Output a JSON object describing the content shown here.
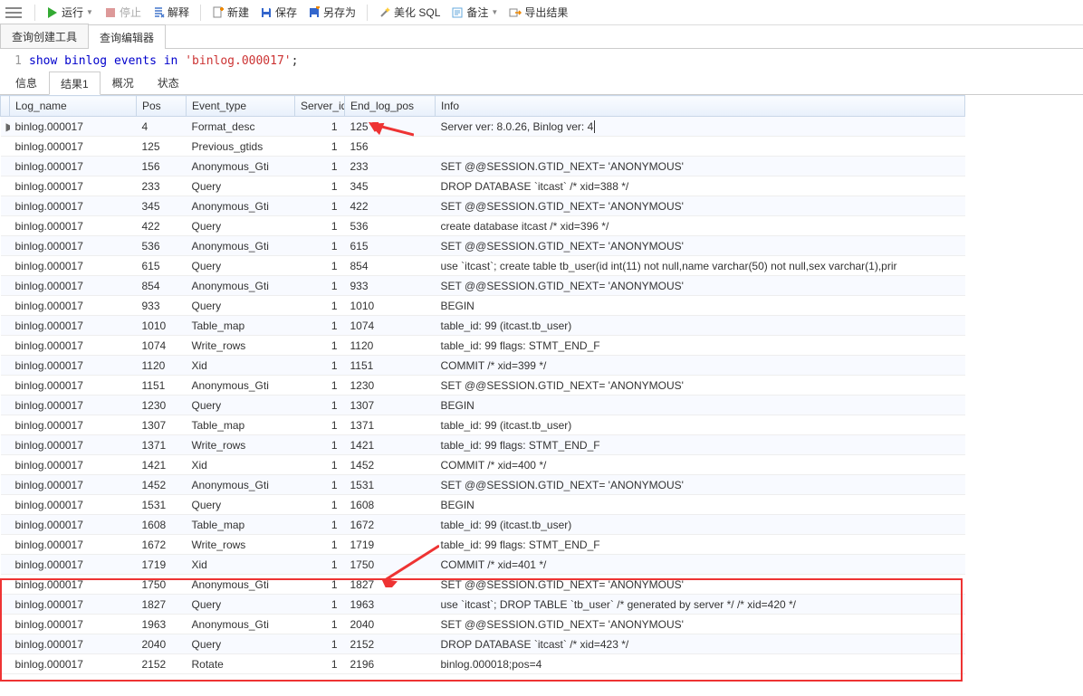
{
  "toolbar": {
    "run": "运行",
    "stop": "停止",
    "explain": "解释",
    "new": "新建",
    "save": "保存",
    "saveas": "另存为",
    "beautify": "美化 SQL",
    "memo": "备注",
    "export": "导出结果"
  },
  "upper_tabs": {
    "builder": "查询创建工具",
    "editor": "查询编辑器"
  },
  "sql": {
    "kw1": "show",
    "kw2": "binlog",
    "kw3": "events",
    "kw4": "in",
    "lit": "'binlog.000017'",
    "term": ";"
  },
  "result_tabs": {
    "info": "信息",
    "result1": "结果1",
    "profile": "概况",
    "status": "状态"
  },
  "columns": {
    "log_name": "Log_name",
    "pos": "Pos",
    "event_type": "Event_type",
    "server_id": "Server_id",
    "end_log_pos": "End_log_pos",
    "info": "Info"
  },
  "rows": [
    {
      "log": "binlog.000017",
      "pos": "4",
      "et": "Format_desc",
      "sid": "1",
      "elp": "125",
      "info": "Server ver: 8.0.26, Binlog ver: 4",
      "cur": true,
      "caret": true
    },
    {
      "log": "binlog.000017",
      "pos": "125",
      "et": "Previous_gtids",
      "sid": "1",
      "elp": "156",
      "info": ""
    },
    {
      "log": "binlog.000017",
      "pos": "156",
      "et": "Anonymous_Gti",
      "sid": "1",
      "elp": "233",
      "info": "SET @@SESSION.GTID_NEXT= 'ANONYMOUS'"
    },
    {
      "log": "binlog.000017",
      "pos": "233",
      "et": "Query",
      "sid": "1",
      "elp": "345",
      "info": "DROP DATABASE `itcast` /* xid=388 */"
    },
    {
      "log": "binlog.000017",
      "pos": "345",
      "et": "Anonymous_Gti",
      "sid": "1",
      "elp": "422",
      "info": "SET @@SESSION.GTID_NEXT= 'ANONYMOUS'"
    },
    {
      "log": "binlog.000017",
      "pos": "422",
      "et": "Query",
      "sid": "1",
      "elp": "536",
      "info": "create database itcast /* xid=396 */"
    },
    {
      "log": "binlog.000017",
      "pos": "536",
      "et": "Anonymous_Gti",
      "sid": "1",
      "elp": "615",
      "info": "SET @@SESSION.GTID_NEXT= 'ANONYMOUS'"
    },
    {
      "log": "binlog.000017",
      "pos": "615",
      "et": "Query",
      "sid": "1",
      "elp": "854",
      "info": "use `itcast`; create table tb_user(id int(11) not null,name varchar(50) not null,sex varchar(1),prir"
    },
    {
      "log": "binlog.000017",
      "pos": "854",
      "et": "Anonymous_Gti",
      "sid": "1",
      "elp": "933",
      "info": "SET @@SESSION.GTID_NEXT= 'ANONYMOUS'"
    },
    {
      "log": "binlog.000017",
      "pos": "933",
      "et": "Query",
      "sid": "1",
      "elp": "1010",
      "info": "BEGIN"
    },
    {
      "log": "binlog.000017",
      "pos": "1010",
      "et": "Table_map",
      "sid": "1",
      "elp": "1074",
      "info": "table_id: 99 (itcast.tb_user)"
    },
    {
      "log": "binlog.000017",
      "pos": "1074",
      "et": "Write_rows",
      "sid": "1",
      "elp": "1120",
      "info": "table_id: 99 flags: STMT_END_F"
    },
    {
      "log": "binlog.000017",
      "pos": "1120",
      "et": "Xid",
      "sid": "1",
      "elp": "1151",
      "info": "COMMIT /* xid=399 */"
    },
    {
      "log": "binlog.000017",
      "pos": "1151",
      "et": "Anonymous_Gti",
      "sid": "1",
      "elp": "1230",
      "info": "SET @@SESSION.GTID_NEXT= 'ANONYMOUS'"
    },
    {
      "log": "binlog.000017",
      "pos": "1230",
      "et": "Query",
      "sid": "1",
      "elp": "1307",
      "info": "BEGIN"
    },
    {
      "log": "binlog.000017",
      "pos": "1307",
      "et": "Table_map",
      "sid": "1",
      "elp": "1371",
      "info": "table_id: 99 (itcast.tb_user)"
    },
    {
      "log": "binlog.000017",
      "pos": "1371",
      "et": "Write_rows",
      "sid": "1",
      "elp": "1421",
      "info": "table_id: 99 flags: STMT_END_F"
    },
    {
      "log": "binlog.000017",
      "pos": "1421",
      "et": "Xid",
      "sid": "1",
      "elp": "1452",
      "info": "COMMIT /* xid=400 */"
    },
    {
      "log": "binlog.000017",
      "pos": "1452",
      "et": "Anonymous_Gti",
      "sid": "1",
      "elp": "1531",
      "info": "SET @@SESSION.GTID_NEXT= 'ANONYMOUS'"
    },
    {
      "log": "binlog.000017",
      "pos": "1531",
      "et": "Query",
      "sid": "1",
      "elp": "1608",
      "info": "BEGIN"
    },
    {
      "log": "binlog.000017",
      "pos": "1608",
      "et": "Table_map",
      "sid": "1",
      "elp": "1672",
      "info": "table_id: 99 (itcast.tb_user)"
    },
    {
      "log": "binlog.000017",
      "pos": "1672",
      "et": "Write_rows",
      "sid": "1",
      "elp": "1719",
      "info": "table_id: 99 flags: STMT_END_F"
    },
    {
      "log": "binlog.000017",
      "pos": "1719",
      "et": "Xid",
      "sid": "1",
      "elp": "1750",
      "info": "COMMIT /* xid=401 */"
    },
    {
      "log": "binlog.000017",
      "pos": "1750",
      "et": "Anonymous_Gti",
      "sid": "1",
      "elp": "1827",
      "info": "SET @@SESSION.GTID_NEXT= 'ANONYMOUS'"
    },
    {
      "log": "binlog.000017",
      "pos": "1827",
      "et": "Query",
      "sid": "1",
      "elp": "1963",
      "info": "use `itcast`; DROP TABLE `tb_user` /* generated by server */ /* xid=420 */"
    },
    {
      "log": "binlog.000017",
      "pos": "1963",
      "et": "Anonymous_Gti",
      "sid": "1",
      "elp": "2040",
      "info": "SET @@SESSION.GTID_NEXT= 'ANONYMOUS'"
    },
    {
      "log": "binlog.000017",
      "pos": "2040",
      "et": "Query",
      "sid": "1",
      "elp": "2152",
      "info": "DROP DATABASE `itcast` /* xid=423 */"
    },
    {
      "log": "binlog.000017",
      "pos": "2152",
      "et": "Rotate",
      "sid": "1",
      "elp": "2196",
      "info": "binlog.000018;pos=4"
    }
  ]
}
